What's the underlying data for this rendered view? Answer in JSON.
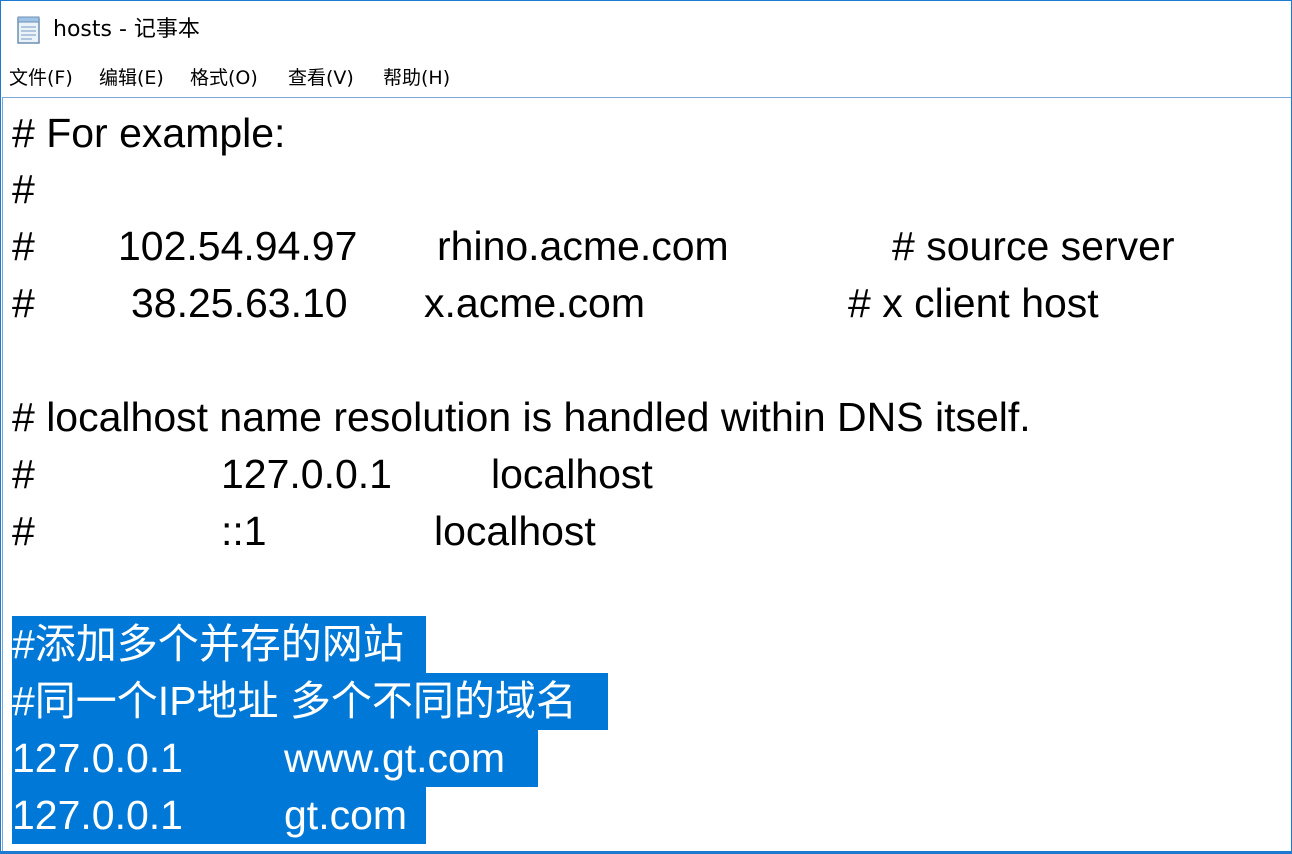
{
  "window": {
    "title": "hosts - 记事本",
    "icon": "notepad-icon"
  },
  "menu": {
    "file": "文件(F)",
    "edit": "编辑(E)",
    "format": "格式(O)",
    "view": "查看(V)",
    "help": "帮助(H)"
  },
  "lines": {
    "l1": "# For example:",
    "l2": "#",
    "l3": {
      "hash": "#",
      "ip": "102.54.94.97",
      "host": "rhino.acme.com",
      "comment": "# source server"
    },
    "l4": {
      "hash": "#",
      "ip": "38.25.63.10",
      "host": "x.acme.com",
      "comment": "# x client host"
    },
    "l6": "# localhost name resolution is handled within DNS itself.",
    "l7": {
      "hash": "#",
      "ip": "127.0.0.1",
      "host": "localhost"
    },
    "l8": {
      "hash": "#",
      "ip": "::1",
      "host": "localhost"
    },
    "l10": "#添加多个并存的网站",
    "l11": "#同一个IP地址 多个不同的域名",
    "l12": {
      "ip": "127.0.0.1",
      "host": "www.gt.com"
    },
    "l13": {
      "ip": "127.0.0.1",
      "host": "gt.com"
    }
  },
  "colors": {
    "selection": "#0078d7",
    "window_border": "#1c7ad0"
  }
}
